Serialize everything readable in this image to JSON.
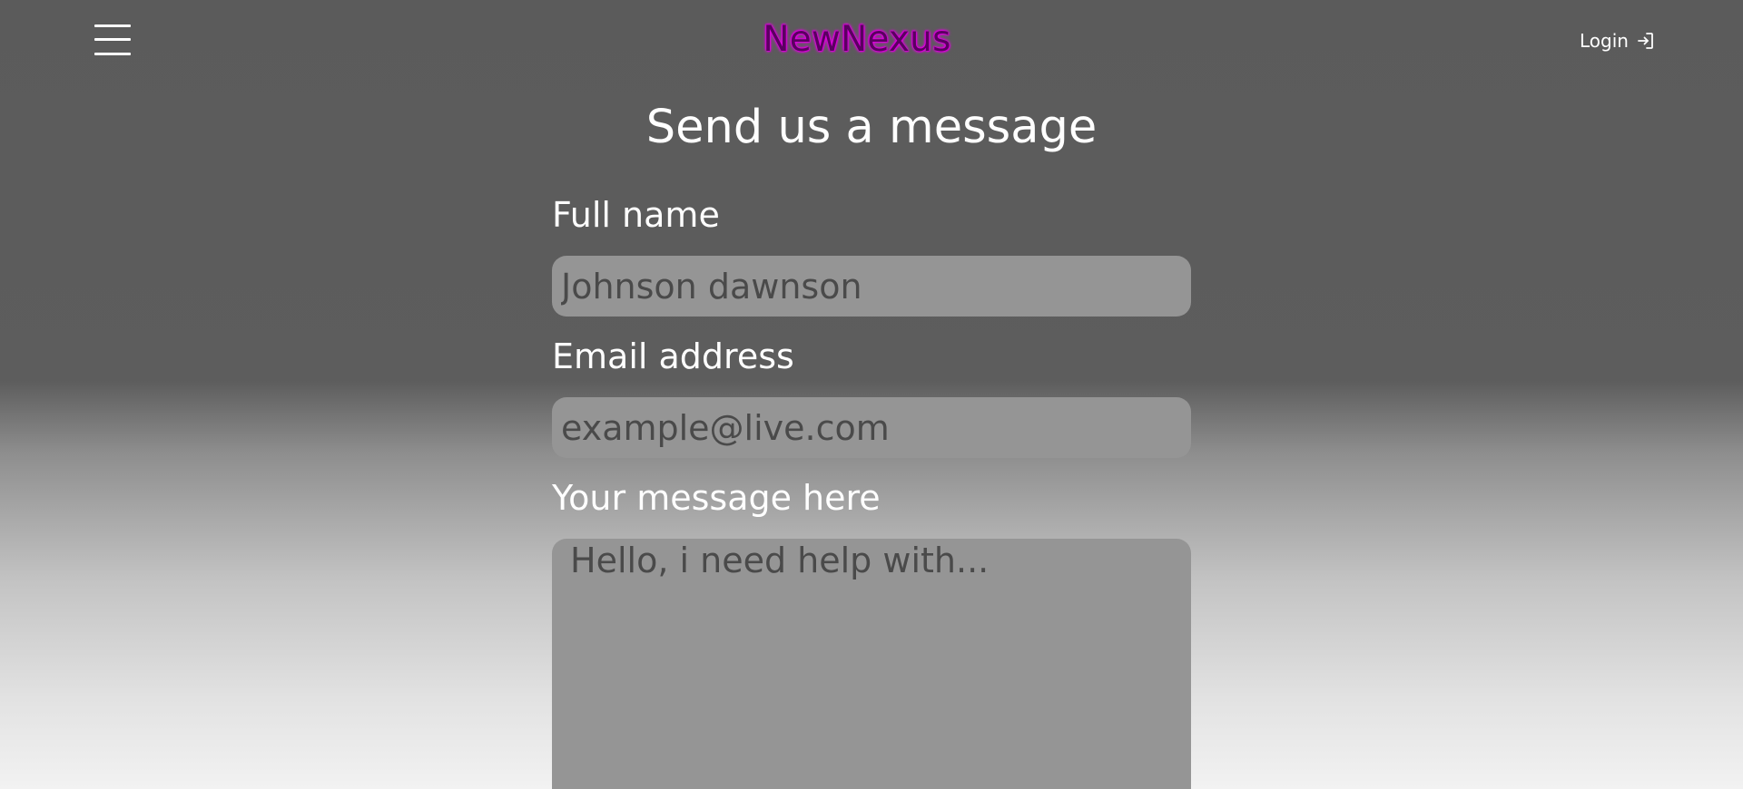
{
  "header": {
    "brand": "NewNexus",
    "login_label": "Login",
    "menu_icon": "hamburger-menu-icon",
    "login_icon": "login-arrow-icon"
  },
  "main": {
    "title": "Send us a message",
    "fields": [
      {
        "label": "Full name",
        "placeholder": "Johnson dawnson"
      },
      {
        "label": "Email address",
        "placeholder": "example@live.com"
      },
      {
        "label": "Your message here",
        "placeholder": "Hello, i need help with..."
      }
    ]
  },
  "colors": {
    "brand_text": "#5a0060",
    "brand_glow": "#ff00ff",
    "field_background": "#959595",
    "placeholder_text": "#4a4a4a"
  }
}
